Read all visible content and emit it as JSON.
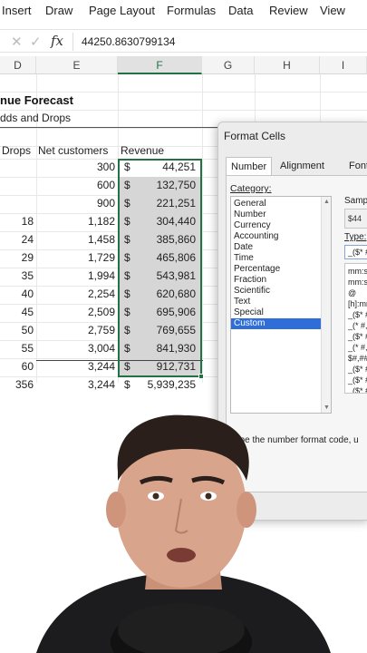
{
  "ribbon": {
    "tabs": [
      "Insert",
      "Draw",
      "Page Layout",
      "Formulas",
      "Data",
      "Review",
      "View"
    ]
  },
  "formula_bar": {
    "cancel_icon": "close-icon",
    "confirm_icon": "check-icon",
    "fx_label": "fx",
    "value": "44250.8630799134"
  },
  "columns": [
    "D",
    "E",
    "F",
    "G",
    "H",
    "I"
  ],
  "sheet": {
    "title": "nue Forecast",
    "subtitle": "dds and Drops",
    "headers": {
      "drops": "Drops",
      "net_customers": "Net customers",
      "revenue": "Revenue"
    },
    "rows": [
      {
        "drops": "",
        "net": "300",
        "cur": "$",
        "rev": "44,251"
      },
      {
        "drops": "",
        "net": "600",
        "cur": "$",
        "rev": "132,750"
      },
      {
        "drops": "",
        "net": "900",
        "cur": "$",
        "rev": "221,251"
      },
      {
        "drops": "18",
        "net": "1,182",
        "cur": "$",
        "rev": "304,440"
      },
      {
        "drops": "24",
        "net": "1,458",
        "cur": "$",
        "rev": "385,860"
      },
      {
        "drops": "29",
        "net": "1,729",
        "cur": "$",
        "rev": "465,806"
      },
      {
        "drops": "35",
        "net": "1,994",
        "cur": "$",
        "rev": "543,981"
      },
      {
        "drops": "40",
        "net": "2,254",
        "cur": "$",
        "rev": "620,680"
      },
      {
        "drops": "45",
        "net": "2,509",
        "cur": "$",
        "rev": "695,906"
      },
      {
        "drops": "50",
        "net": "2,759",
        "cur": "$",
        "rev": "769,655"
      },
      {
        "drops": "55",
        "net": "3,004",
        "cur": "$",
        "rev": "841,930"
      },
      {
        "drops": "60",
        "net": "3,244",
        "cur": "$",
        "rev": "912,731"
      },
      {
        "drops": "356",
        "net": "3,244",
        "cur": "$",
        "rev": "5,939,235"
      }
    ]
  },
  "dialog": {
    "title": "Format Cells",
    "tabs": [
      "Number",
      "Alignment",
      "Font"
    ],
    "active_tab": "Number",
    "category_label": "Category:",
    "categories": [
      "General",
      "Number",
      "Currency",
      "Accounting",
      "Date",
      "Time",
      "Percentage",
      "Fraction",
      "Scientific",
      "Text",
      "Special",
      "Custom"
    ],
    "selected_category": "Custom",
    "sample_label": "Samp",
    "sample_value": "$44",
    "type_label": "Type:",
    "type_value": "_($* #",
    "format_list": [
      "mm:ss",
      "mm:ss",
      "@",
      "[h]:mm",
      "_($* #",
      "_(* #,",
      "_($* #",
      "_(* #,",
      "$#,##",
      "_($* #",
      "_($* #",
      "_($* #"
    ],
    "hint": "Type the number format code, u"
  },
  "colors": {
    "excel_green": "#217346",
    "selection_blue": "#2f6ed8",
    "selected_range_fill": "#d6d6d6"
  }
}
